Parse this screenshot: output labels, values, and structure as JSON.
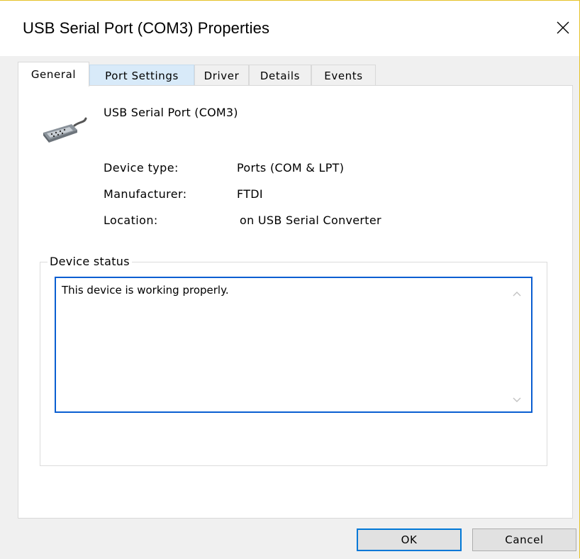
{
  "window": {
    "title": "USB Serial Port (COM3) Properties"
  },
  "tabs": [
    {
      "label": "General"
    },
    {
      "label": "Port Settings"
    },
    {
      "label": "Driver"
    },
    {
      "label": "Details"
    },
    {
      "label": "Events"
    }
  ],
  "device": {
    "name": "USB Serial Port (COM3)",
    "icon": "serial-port-connector-icon",
    "properties": [
      {
        "label": "Device type:",
        "value": "Ports (COM & LPT)"
      },
      {
        "label": "Manufacturer:",
        "value": "FTDI"
      },
      {
        "label": "Location:",
        "value": "on USB Serial Converter"
      }
    ]
  },
  "status": {
    "group_label": "Device status",
    "text": "This device is working properly."
  },
  "buttons": {
    "ok": "OK",
    "cancel": "Cancel"
  },
  "colors": {
    "accent": "#0078d7",
    "focus_border": "#0a5ed1",
    "window_border": "#e6c229",
    "hover_tab": "#d8eaf9",
    "dialog_bg": "#f0f0f0"
  }
}
